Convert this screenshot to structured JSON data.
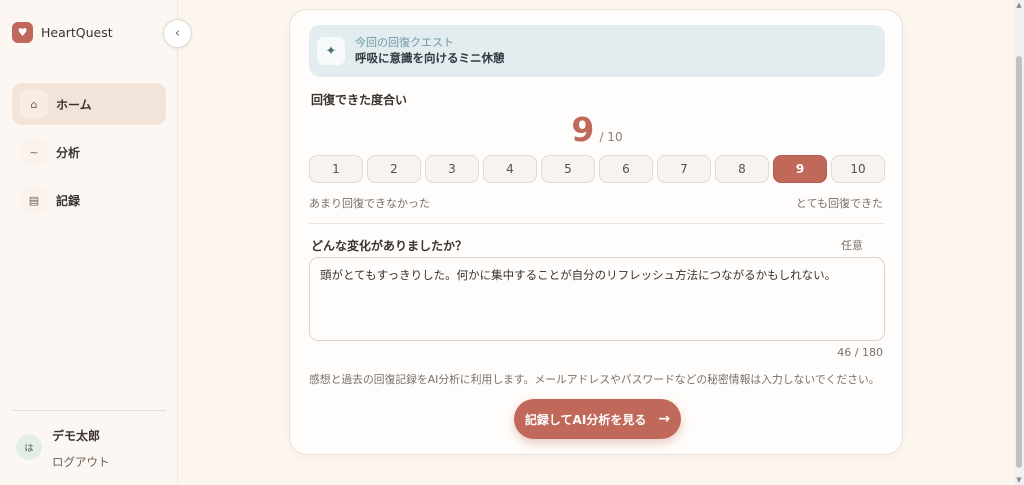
{
  "app": {
    "name": "HeartQuest"
  },
  "sidebar": {
    "collapse_icon": "‹",
    "items": [
      {
        "label": "ホーム",
        "icon": "home-icon",
        "glyph": "⌂",
        "active": true
      },
      {
        "label": "分析",
        "icon": "trend-icon",
        "glyph": "~",
        "active": false
      },
      {
        "label": "記録",
        "icon": "list-icon",
        "glyph": "▤",
        "active": false
      }
    ],
    "user": {
      "avatar_text": "は",
      "name": "デモ太郎",
      "logout": "ログアウト"
    }
  },
  "quest": {
    "icon": "sparkle-icon",
    "kicker": "今回の回復クエスト",
    "title": "呼吸に意識を向けるミニ休憩"
  },
  "recovery": {
    "label": "回復できた度合い",
    "value": "9",
    "total": "/ 10",
    "scale": [
      "1",
      "2",
      "3",
      "4",
      "5",
      "6",
      "7",
      "8",
      "9",
      "10"
    ],
    "selected_index": 8,
    "low_hint": "あまり回復できなかった",
    "high_hint": "とても回復できた"
  },
  "change": {
    "label": "どんな変化がありましたか？",
    "optional": "任意",
    "text": "頭がとてもすっきりした。何かに集中することが自分のリフレッシュ方法につながるかもしれない。",
    "counter": "46 / 180"
  },
  "privacy_note": "感想と過去の回復記録をAI分析に利用します。メールアドレスやパスワードなどの秘密情報は入力しないでください。",
  "submit": {
    "label": "記録してAI分析を見る",
    "arrow": "→"
  },
  "colors": {
    "accent": "#c0685a",
    "quest_bg": "#e3ecef",
    "background": "#fdf6ef"
  }
}
